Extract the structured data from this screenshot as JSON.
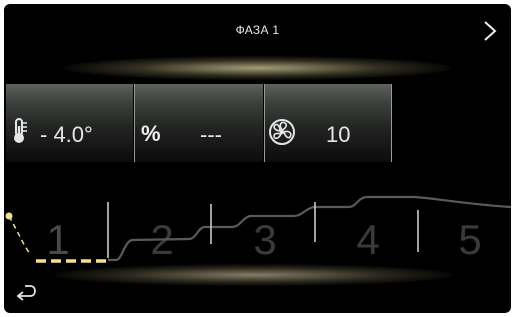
{
  "header": {
    "title": "ФАЗА 1",
    "next_icon": "chevron-right-icon"
  },
  "readings": {
    "temperature": {
      "icon": "thermometer-icon",
      "value": "- 4.0°"
    },
    "humidity": {
      "symbol": "%",
      "value": "---"
    },
    "fan": {
      "icon": "fan-icon",
      "value": "10"
    }
  },
  "phases": {
    "labels": [
      "1",
      "2",
      "3",
      "4",
      "5"
    ],
    "active": 1
  },
  "footer": {
    "back_icon": "return-arrow-icon"
  },
  "colors": {
    "accent": "#f2e38a",
    "profile": "#5a5a5a",
    "divider": "#d8d8d8"
  }
}
